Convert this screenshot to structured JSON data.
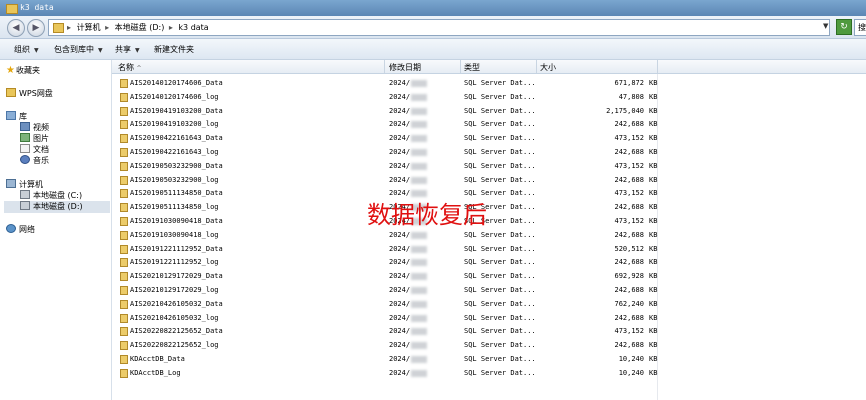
{
  "window": {
    "title": "k3 data",
    "accent": "#6b97c4"
  },
  "address": {
    "crumbs": [
      "计算机",
      "本地磁盘 (D:)",
      "k3 data"
    ],
    "dropdown_icon": "chevron-down-icon",
    "refresh_icon": "refresh-arrow-icon",
    "search_placeholder": "搜"
  },
  "toolbar": {
    "items": [
      {
        "label": "组织",
        "has_arrow": true
      },
      {
        "label": "包含到库中",
        "has_arrow": true
      },
      {
        "label": "共享",
        "has_arrow": true
      },
      {
        "label": "新建文件夹",
        "has_arrow": false
      }
    ]
  },
  "nav": {
    "favorites": "收藏夹",
    "wps": "WPS网盘",
    "library": "库",
    "lib_items": [
      "视频",
      "图片",
      "文档",
      "音乐"
    ],
    "computer": "计算机",
    "drives": [
      "本地磁盘 (C:)",
      "本地磁盘 (D:)"
    ],
    "network": "网络"
  },
  "columns": {
    "name": "名称",
    "date": "修改日期",
    "type": "类型",
    "size": "大小",
    "sort_indicator": "^"
  },
  "files": [
    {
      "name": "AIS20140120174606_Data",
      "date": "2024/",
      "type": "SQL Server Dat...",
      "size": "671,872",
      "unit": "KB"
    },
    {
      "name": "AIS20140120174606_log",
      "date": "2024/",
      "type": "SQL Server Dat...",
      "size": "47,808",
      "unit": "KB"
    },
    {
      "name": "AIS20190419103200_Data",
      "date": "2024/",
      "type": "SQL Server Dat...",
      "size": "2,175,040",
      "unit": "KB"
    },
    {
      "name": "AIS20190419103200_log",
      "date": "2024/",
      "type": "SQL Server Dat...",
      "size": "242,688",
      "unit": "KB"
    },
    {
      "name": "AIS20190422161643_Data",
      "date": "2024/",
      "type": "SQL Server Dat...",
      "size": "473,152",
      "unit": "KB"
    },
    {
      "name": "AIS20190422161643_log",
      "date": "2024/",
      "type": "SQL Server Dat...",
      "size": "242,688",
      "unit": "KB"
    },
    {
      "name": "AIS20190503232900_Data",
      "date": "2024/",
      "type": "SQL Server Dat...",
      "size": "473,152",
      "unit": "KB"
    },
    {
      "name": "AIS20190503232900_log",
      "date": "2024/",
      "type": "SQL Server Dat...",
      "size": "242,688",
      "unit": "KB"
    },
    {
      "name": "AIS20190511134850_Data",
      "date": "2024/",
      "type": "SQL Server Dat...",
      "size": "473,152",
      "unit": "KB"
    },
    {
      "name": "AIS20190511134850_log",
      "date": "2024/",
      "type": "SQL Server Dat...",
      "size": "242,688",
      "unit": "KB"
    },
    {
      "name": "AIS20191030090418_Data",
      "date": "2024/",
      "type": "SQL Server Dat...",
      "size": "473,152",
      "unit": "KB"
    },
    {
      "name": "AIS20191030090418_log",
      "date": "2024/",
      "type": "SQL Server Dat...",
      "size": "242,688",
      "unit": "KB"
    },
    {
      "name": "AIS20191221112952_Data",
      "date": "2024/",
      "type": "SQL Server Dat...",
      "size": "520,512",
      "unit": "KB"
    },
    {
      "name": "AIS20191221112952_log",
      "date": "2024/",
      "type": "SQL Server Dat...",
      "size": "242,688",
      "unit": "KB"
    },
    {
      "name": "AIS20210129172029_Data",
      "date": "2024/",
      "type": "SQL Server Dat...",
      "size": "692,928",
      "unit": "KB"
    },
    {
      "name": "AIS20210129172029_log",
      "date": "2024/",
      "type": "SQL Server Dat...",
      "size": "242,688",
      "unit": "KB"
    },
    {
      "name": "AIS20210426105032_Data",
      "date": "2024/",
      "type": "SQL Server Dat...",
      "size": "762,240",
      "unit": "KB"
    },
    {
      "name": "AIS20210426105032_log",
      "date": "2024/",
      "type": "SQL Server Dat...",
      "size": "242,688",
      "unit": "KB"
    },
    {
      "name": "AIS20220822125652_Data",
      "date": "2024/",
      "type": "SQL Server Dat...",
      "size": "473,152",
      "unit": "KB"
    },
    {
      "name": "AIS20220822125652_log",
      "date": "2024/",
      "type": "SQL Server Dat...",
      "size": "242,688",
      "unit": "KB"
    },
    {
      "name": "KDAcctDB_Data",
      "date": "2024/",
      "type": "SQL Server Dat...",
      "size": "10,240",
      "unit": "KB"
    },
    {
      "name": "KDAcctDB_Log",
      "date": "2024/",
      "type": "SQL Server Dat...",
      "size": "10,240",
      "unit": "KB"
    }
  ],
  "overlay": {
    "text": "数据恢复后",
    "color": "#e01010"
  }
}
